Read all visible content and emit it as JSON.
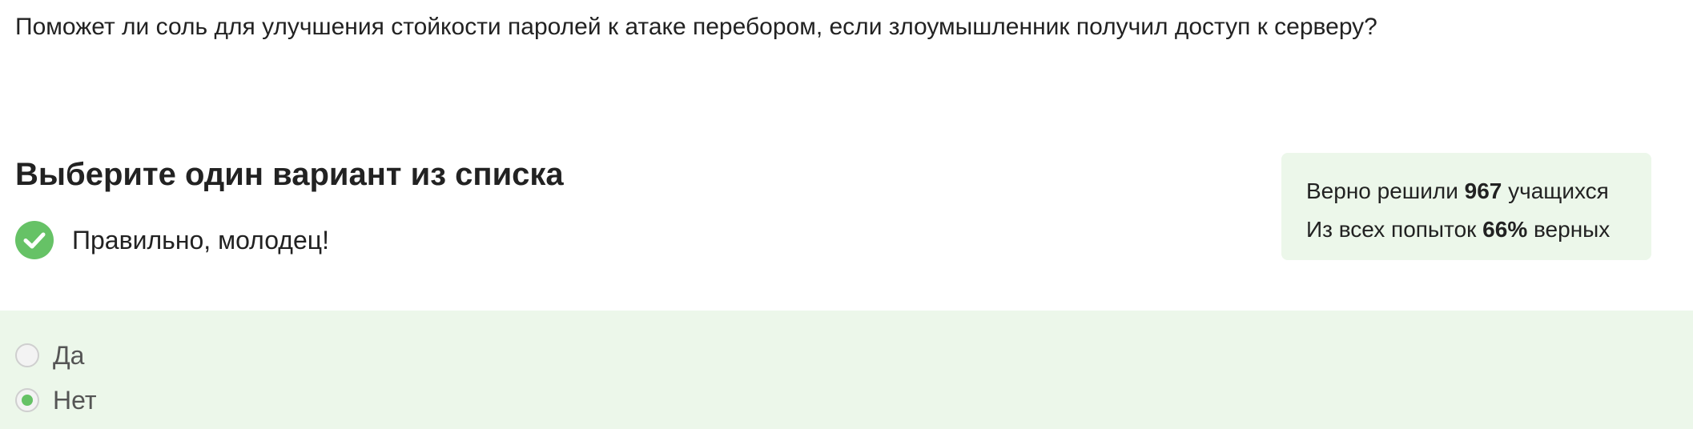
{
  "question": {
    "text": "Поможет ли соль для улучшения стойкости паролей к атаке перебором, если злоумышленник получил доступ к серверу?"
  },
  "task": {
    "title": "Выберите один вариант из списка"
  },
  "feedback": {
    "icon": "checkmark-icon",
    "text": "Правильно, молодец!",
    "color": "#66c266"
  },
  "stats": {
    "solved_prefix": "Верно решили ",
    "solved_count": "967",
    "solved_suffix": " учащихся",
    "attempts_prefix": "Из всех попыток ",
    "attempts_percent": "66%",
    "attempts_suffix": " верных",
    "background": "#ecf7ea"
  },
  "options": [
    {
      "label": "Да",
      "selected": false
    },
    {
      "label": "Нет",
      "selected": true
    }
  ]
}
